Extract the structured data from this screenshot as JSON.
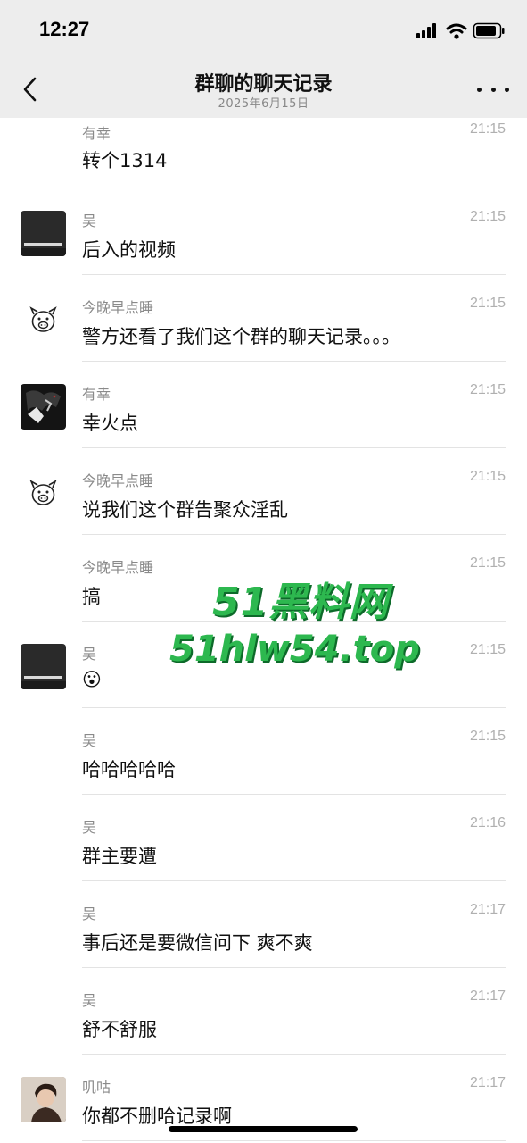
{
  "status_bar": {
    "time": "12:27"
  },
  "header": {
    "title": "群聊的聊天记录",
    "date": "2025年6月15日"
  },
  "messages": [
    {
      "sender": "有幸",
      "time": "21:15",
      "text": "转个1314",
      "avatar": "none"
    },
    {
      "sender": "吴",
      "time": "21:15",
      "text": "后入的视频",
      "avatar": "dark-screen-avatar"
    },
    {
      "sender": "今晚早点睡",
      "time": "21:15",
      "text": "警方还看了我们这个群的聊天记录。。。",
      "avatar": "pig-sketch-avatar"
    },
    {
      "sender": "有幸",
      "time": "21:15",
      "text": "幸火点",
      "avatar": "dark-art-avatar"
    },
    {
      "sender": "今晚早点睡",
      "time": "21:15",
      "text": "说我们这个群告聚众淫乱",
      "avatar": "pig-sketch-avatar"
    },
    {
      "sender": "今晚早点睡",
      "time": "21:15",
      "text": "搞",
      "avatar": "none"
    },
    {
      "sender": "吴",
      "time": "21:15",
      "text": "😮",
      "avatar": "dark-screen-avatar"
    },
    {
      "sender": "吴",
      "time": "21:15",
      "text": "哈哈哈哈哈",
      "avatar": "none"
    },
    {
      "sender": "吴",
      "time": "21:16",
      "text": "群主要遭",
      "avatar": "none"
    },
    {
      "sender": "吴",
      "time": "21:17",
      "text": "事后还是要微信问下 爽不爽",
      "avatar": "none"
    },
    {
      "sender": "吴",
      "time": "21:17",
      "text": "舒不舒服",
      "avatar": "none"
    },
    {
      "sender": "叽咕",
      "time": "21:17",
      "text": "你都不删哈记录啊",
      "avatar": "photo-avatar"
    }
  ],
  "watermark": {
    "line1": "51黑料网",
    "line2": "51hlw54.top"
  },
  "colors": {
    "header_bg": "#ededed",
    "watermark": "#2db84f"
  }
}
